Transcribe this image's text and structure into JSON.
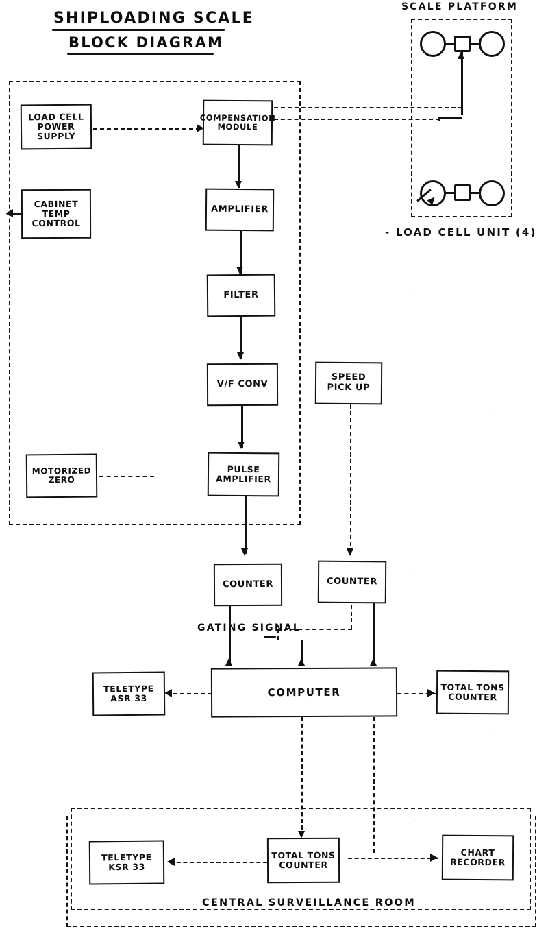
{
  "diagram": {
    "title_line1": "SHIPLOADING  SCALE",
    "title_line2": "BLOCK DIAGRAM",
    "platform_label": "SCALE  PLATFORM",
    "load_cell_unit_label": "- LOAD CELL UNIT (4)",
    "gating_signal_label": "GATING SIGNAL",
    "central_room_label": "CENTRAL  SURVEILLANCE  ROOM"
  },
  "boxes": {
    "load_cell_power_supply": "LOAD CELL\nPOWER SUPPLY",
    "compensation_module": "COMPENSATION\nMODULE",
    "cabinet_temp_control": "CABINET\nTEMP\nCONTROL",
    "amplifier": "AMPLIFIER",
    "filter": "FILTER",
    "vf_conv": "V/F CONV",
    "speed_pick_up": "SPEED\nPICK UP",
    "motorized_zero": "MOTORIZED\nZERO",
    "pulse_amplifier": "PULSE\nAMPLIFIER",
    "counter_left": "COUNTER",
    "counter_right": "COUNTER",
    "computer": "COMPUTER",
    "teletype_asr": "TELETYPE\nASR 33",
    "total_tons_counter_upper": "TOTAL TONS\nCOUNTER",
    "teletype_ksr": "TELETYPE\nKSR 33",
    "total_tons_counter_lower": "TOTAL TONS\nCOUNTER",
    "chart_recorder": "CHART\nRECORDER"
  },
  "colors": {
    "ink": "#121212",
    "paper": "#ffffff"
  }
}
